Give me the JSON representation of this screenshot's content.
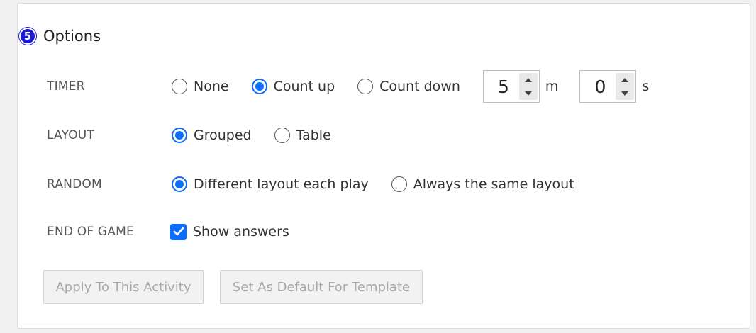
{
  "section": {
    "step_number": "5",
    "title": "Options"
  },
  "timer": {
    "label": "TIMER",
    "options": [
      "None",
      "Count up",
      "Count down"
    ],
    "selected": "Count up",
    "minutes_value": "5",
    "minutes_unit": "m",
    "seconds_value": "0",
    "seconds_unit": "s"
  },
  "layout": {
    "label": "LAYOUT",
    "options": [
      "Grouped",
      "Table"
    ],
    "selected": "Grouped"
  },
  "random": {
    "label": "RANDOM",
    "options": [
      "Different layout each play",
      "Always the same layout"
    ],
    "selected": "Different layout each play"
  },
  "end_of_game": {
    "label": "END OF GAME",
    "show_answers_label": "Show answers",
    "show_answers_checked": true
  },
  "buttons": {
    "apply_label": "Apply To This Activity",
    "default_label": "Set As Default For Template"
  },
  "colors": {
    "accent": "#0d6efd",
    "badge": "#1a1adb"
  }
}
